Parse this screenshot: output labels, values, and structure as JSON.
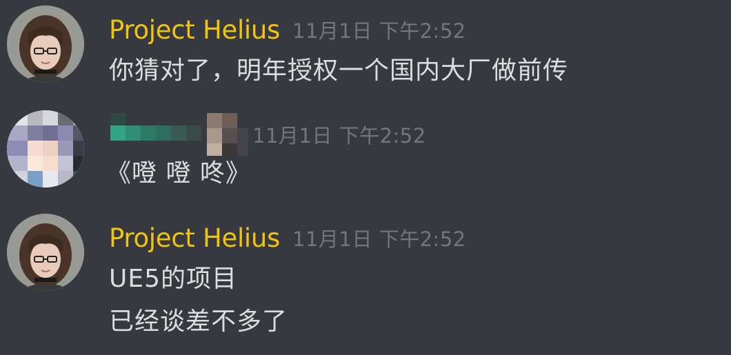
{
  "messages": [
    {
      "author": "Project Helius",
      "timestamp": "11月1日 下午2:52",
      "lines": [
        "你猜对了，明年授权一个国内大厂做前传"
      ]
    },
    {
      "author": "",
      "timestamp": "11月1日 下午2:52",
      "lines": [
        "《噔 噔 咚》"
      ]
    },
    {
      "author": "Project Helius",
      "timestamp": "11月1日 下午2:52",
      "lines": [
        "UE5的项目",
        "已经谈差不多了"
      ]
    }
  ],
  "colors": {
    "background": "#36393f",
    "username": "#f1c40f",
    "timestamp": "#72767d",
    "message_text": "#dcddde"
  },
  "icons": {
    "avatar_1": "anime-girl-glasses-avatar",
    "avatar_2": "pixelated-avatar",
    "avatar_3": "anime-girl-glasses-avatar"
  }
}
